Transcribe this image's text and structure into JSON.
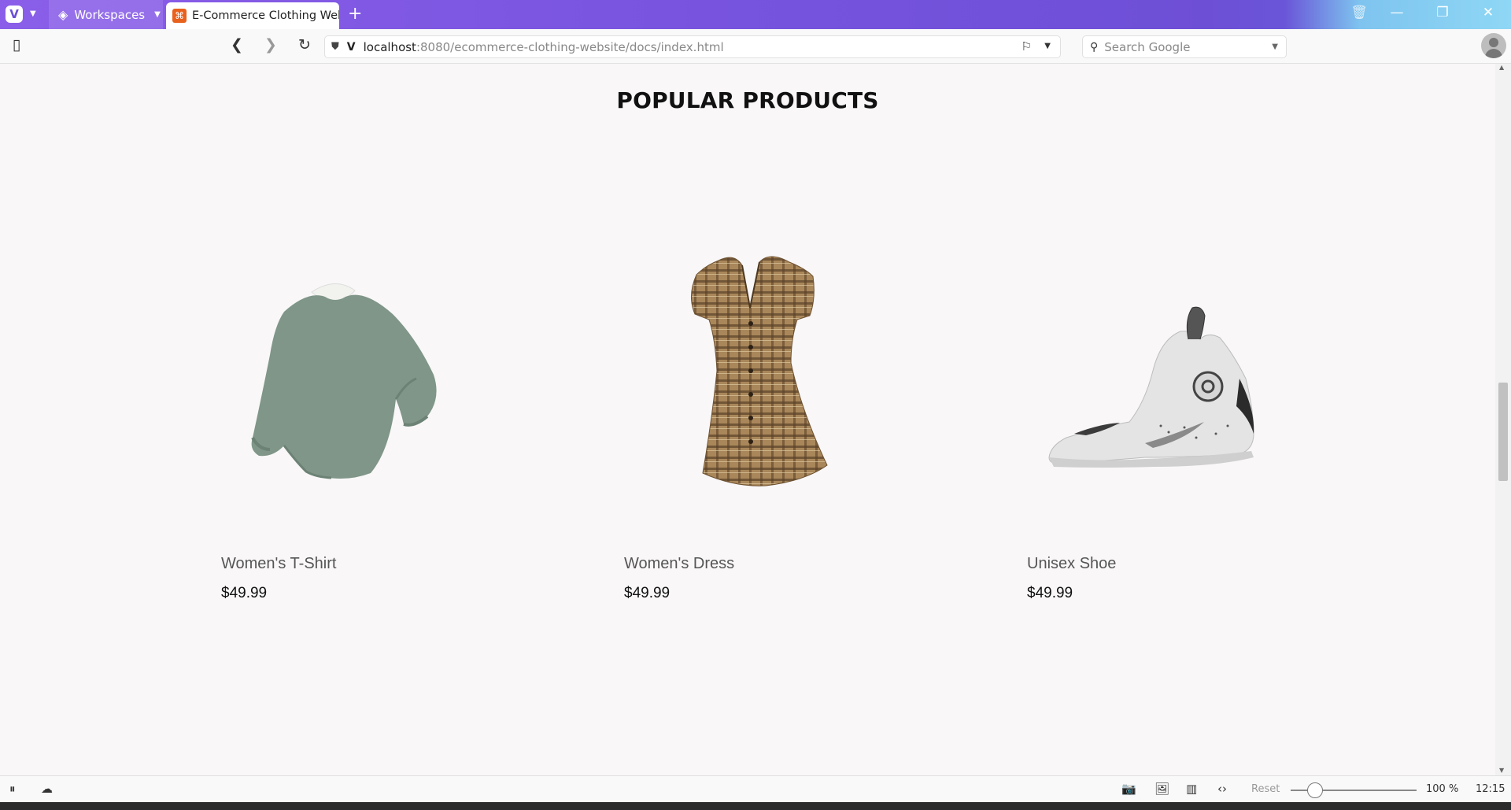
{
  "browser": {
    "workspaces_label": "Workspaces",
    "tab_title": "E-Commerce Clothing Website",
    "url_host": "localhost",
    "url_path": ":8080/ecommerce-clothing-website/docs/index.html",
    "search_placeholder": "Search Google"
  },
  "page": {
    "section_title": "POPULAR PRODUCTS",
    "products": [
      {
        "name": "Women's T-Shirt",
        "price": "$49.99",
        "image": "green-sweatshirt"
      },
      {
        "name": "Women's Dress",
        "price": "$49.99",
        "image": "plaid-dress"
      },
      {
        "name": "Unisex Shoe",
        "price": "$49.99",
        "image": "white-sneaker"
      }
    ]
  },
  "statusbar": {
    "reset_label": "Reset",
    "zoom": "100 %",
    "clock": "12:15"
  },
  "colors": {
    "tabbar_accent": "#7a55e0",
    "page_background": "#f9f7f8",
    "sweatshirt": "#7f9688",
    "dress": "#9d7a4e",
    "shoe": "#e4e4e4"
  }
}
